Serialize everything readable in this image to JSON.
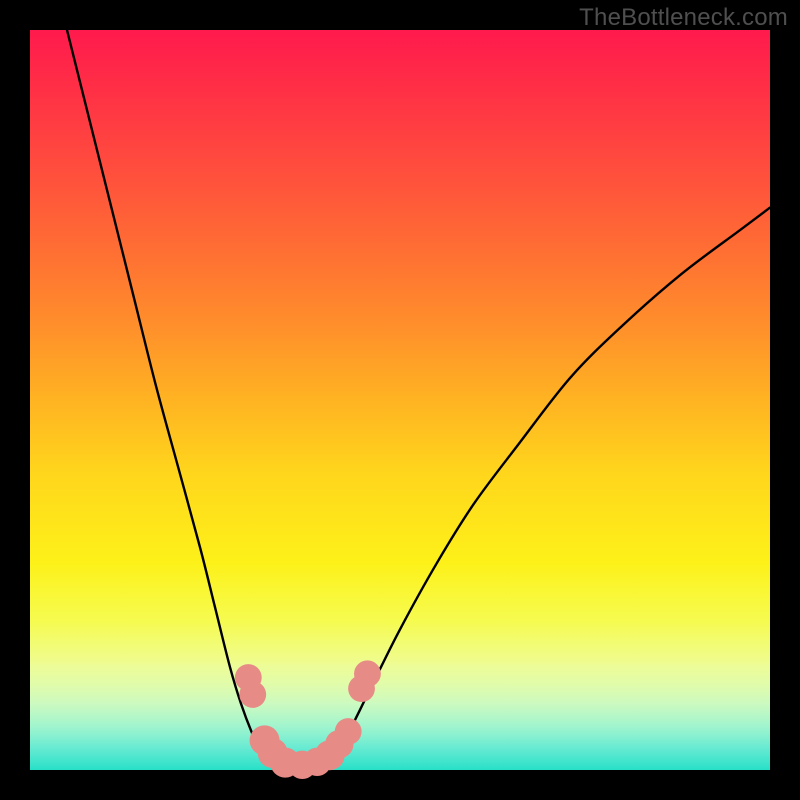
{
  "watermark": "TheBottleneck.com",
  "colors": {
    "frame": "#000000",
    "gradient_top": "#ff1a4d",
    "gradient_bottom": "#27e0c8",
    "curve": "#000000",
    "marker_fill": "#e78b87",
    "marker_stroke": "#d36a66"
  },
  "chart_data": {
    "type": "line",
    "title": "",
    "xlabel": "",
    "ylabel": "",
    "xlim": [
      0,
      100
    ],
    "ylim": [
      0,
      100
    ],
    "grid": false,
    "legend": false,
    "series": [
      {
        "name": "left-branch",
        "x": [
          5,
          8,
          11,
          14,
          17,
          20,
          23,
          25,
          27,
          28.5,
          30,
          31,
          32
        ],
        "y": [
          100,
          88,
          76,
          64,
          52,
          41,
          30,
          22,
          14,
          9,
          5,
          3,
          1.5
        ]
      },
      {
        "name": "valley-floor",
        "x": [
          32,
          33.5,
          35,
          36.5,
          38,
          39.5,
          41
        ],
        "y": [
          1.5,
          0.6,
          0.3,
          0.2,
          0.3,
          0.7,
          2
        ]
      },
      {
        "name": "right-branch",
        "x": [
          41,
          43,
          46,
          50,
          55,
          60,
          66,
          73,
          80,
          88,
          96,
          100
        ],
        "y": [
          2,
          5,
          11,
          19,
          28,
          36,
          44,
          53,
          60,
          67,
          73,
          76
        ]
      }
    ],
    "markers": [
      {
        "x": 29.5,
        "y": 12.5,
        "r": 1.6
      },
      {
        "x": 30.1,
        "y": 10.2,
        "r": 1.6
      },
      {
        "x": 31.7,
        "y": 4.0,
        "r": 2.0
      },
      {
        "x": 32.8,
        "y": 2.3,
        "r": 2.0
      },
      {
        "x": 34.5,
        "y": 1.0,
        "r": 2.0
      },
      {
        "x": 36.8,
        "y": 0.7,
        "r": 1.8
      },
      {
        "x": 38.8,
        "y": 1.1,
        "r": 1.8
      },
      {
        "x": 40.5,
        "y": 2.0,
        "r": 2.0
      },
      {
        "x": 41.8,
        "y": 3.5,
        "r": 1.8
      },
      {
        "x": 43.0,
        "y": 5.2,
        "r": 1.6
      },
      {
        "x": 44.8,
        "y": 11.0,
        "r": 1.6
      },
      {
        "x": 45.6,
        "y": 13.0,
        "r": 1.6
      }
    ],
    "background_gradient": {
      "direction": "top-to-bottom",
      "stops": [
        {
          "pos": 0.0,
          "color": "#ff1a4d"
        },
        {
          "pos": 0.5,
          "color": "#ffb322"
        },
        {
          "pos": 0.75,
          "color": "#fdf119"
        },
        {
          "pos": 1.0,
          "color": "#27e0c8"
        }
      ]
    }
  }
}
